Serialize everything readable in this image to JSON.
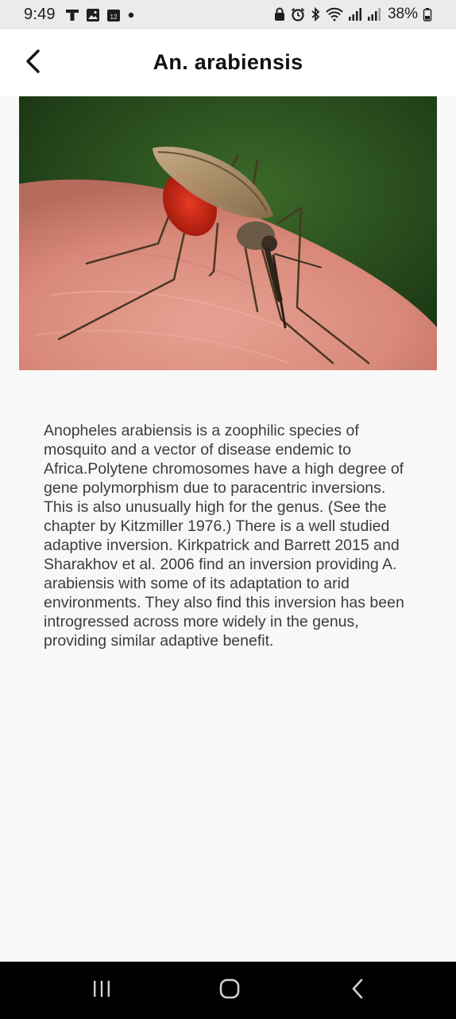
{
  "status_bar": {
    "time": "9:49",
    "left_icons": [
      "t-app-icon",
      "gallery-icon",
      "calendar-icon",
      "notification-dot-icon"
    ],
    "calendar_day": "12",
    "right_icons": [
      "lock-icon",
      "alarm-icon",
      "bluetooth-icon",
      "wifi-icon",
      "signal-icon",
      "signal-icon",
      "battery-icon"
    ],
    "battery": "38%"
  },
  "header": {
    "back_icon": "chevron-left-icon",
    "title": "An. arabiensis"
  },
  "photo": {
    "subject": "mosquito-photo"
  },
  "description": "Anopheles arabiensis is a zoophilic species of mosquito and a vector of disease endemic to Africa.Polytene chromosomes have a high degree of gene polymorphism due to paracentric inversions. This is also unusually high for the genus. (See the chapter by Kitzmiller 1976.) There is a well studied adaptive inversion. Kirkpatrick and Barrett 2015 and Sharakhov et al. 2006 find an inversion providing A. arabiensis with some of its adaptation to arid environments. They also find this inversion has been introgressed across more widely in the genus, providing similar adaptive benefit.",
  "nav_bar": {
    "icons": [
      "recent-apps-icon",
      "home-icon",
      "back-icon"
    ]
  }
}
